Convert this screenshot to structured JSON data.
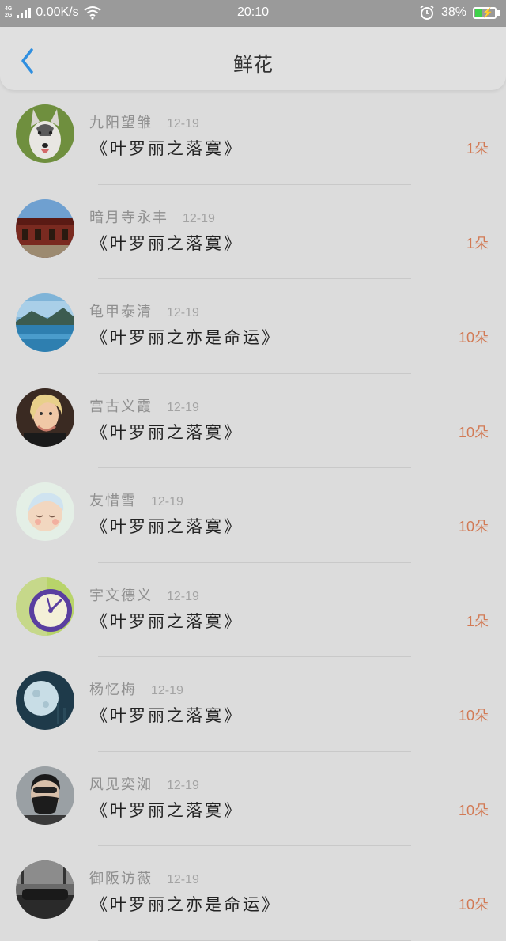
{
  "status_bar": {
    "net_top": "4G",
    "net_bottom": "2G",
    "speed": "0.00K/s",
    "time": "20:10",
    "battery": "38%",
    "battery_level": 0.38,
    "icons": [
      "signal-icon",
      "wifi-icon",
      "alarm-icon",
      "battery-icon"
    ]
  },
  "header": {
    "title": "鲜花",
    "back_icon": "chevron-left-icon"
  },
  "colors": {
    "accent_blue": "#2f8fe0",
    "quantity": "#d27a55"
  },
  "items": [
    {
      "name": "九阳望雏",
      "date": "12-19",
      "book": "《叶罗丽之落寞》",
      "quantity": "1朵",
      "avatar": "husky-dog"
    },
    {
      "name": "暗月寺永丰",
      "date": "12-19",
      "book": "《叶罗丽之落寞》",
      "quantity": "1朵",
      "avatar": "building"
    },
    {
      "name": "龟甲泰清",
      "date": "12-19",
      "book": "《叶罗丽之亦是命运》",
      "quantity": "10朵",
      "avatar": "lake-landscape"
    },
    {
      "name": "宫古义霞",
      "date": "12-19",
      "book": "《叶罗丽之落寞》",
      "quantity": "10朵",
      "avatar": "woman-portrait"
    },
    {
      "name": "友惜雪",
      "date": "12-19",
      "book": "《叶罗丽之落寞》",
      "quantity": "10朵",
      "avatar": "baby-drawing"
    },
    {
      "name": "宇文德义",
      "date": "12-19",
      "book": "《叶罗丽之落寞》",
      "quantity": "1朵",
      "avatar": "clock"
    },
    {
      "name": "杨忆梅",
      "date": "12-19",
      "book": "《叶罗丽之落寞》",
      "quantity": "10朵",
      "avatar": "moon"
    },
    {
      "name": "风见奕洳",
      "date": "12-19",
      "book": "《叶罗丽之落寞》",
      "quantity": "10朵",
      "avatar": "masked-man"
    },
    {
      "name": "御阪访薇",
      "date": "12-19",
      "book": "《叶罗丽之亦是命运》",
      "quantity": "10朵",
      "avatar": "car-street"
    }
  ]
}
